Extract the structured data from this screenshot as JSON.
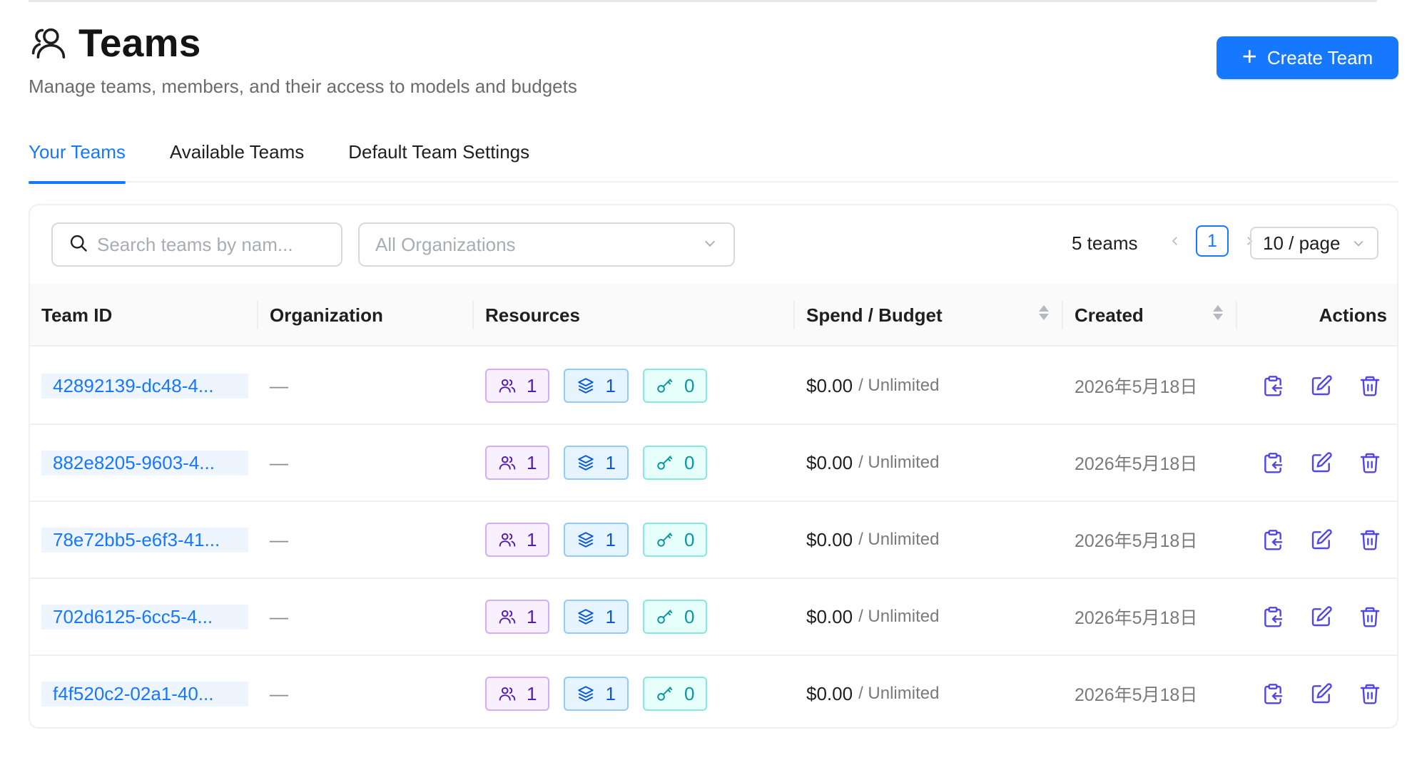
{
  "header": {
    "title": "Teams",
    "subtitle": "Manage teams, members, and their access to models and budgets",
    "create_button_label": "Create Team"
  },
  "tabs": [
    {
      "label": "Your Teams",
      "active": true
    },
    {
      "label": "Available Teams",
      "active": false
    },
    {
      "label": "Default Team Settings",
      "active": false
    }
  ],
  "toolbar": {
    "search_placeholder": "Search teams by nam...",
    "org_select_value": "All Organizations",
    "team_count": "5 teams",
    "current_page": "1",
    "page_size": "10 / page"
  },
  "table": {
    "columns": [
      "Team ID",
      "Organization",
      "Resources",
      "Spend / Budget",
      "Created",
      "Actions"
    ],
    "rows": [
      {
        "team_id": "42892139-dc48-4...",
        "organization": "—",
        "members": "1",
        "models": "1",
        "keys": "0",
        "spend": "$0.00",
        "budget": "/ Unlimited",
        "created": "2026年5月18日"
      },
      {
        "team_id": "882e8205-9603-4...",
        "organization": "—",
        "members": "1",
        "models": "1",
        "keys": "0",
        "spend": "$0.00",
        "budget": "/ Unlimited",
        "created": "2026年5月18日"
      },
      {
        "team_id": "78e72bb5-e6f3-41...",
        "organization": "—",
        "members": "1",
        "models": "1",
        "keys": "0",
        "spend": "$0.00",
        "budget": "/ Unlimited",
        "created": "2026年5月18日"
      },
      {
        "team_id": "702d6125-6cc5-4...",
        "organization": "—",
        "members": "1",
        "models": "1",
        "keys": "0",
        "spend": "$0.00",
        "budget": "/ Unlimited",
        "created": "2026年5月18日"
      },
      {
        "team_id": "f4f520c2-02a1-40...",
        "organization": "—",
        "members": "1",
        "models": "1",
        "keys": "0",
        "spend": "$0.00",
        "budget": "/ Unlimited",
        "created": "2026年5月18日"
      }
    ]
  },
  "colors": {
    "accent": "#1677ff",
    "members_badge": "#531dab",
    "models_badge": "#0958d9",
    "keys_badge": "#08979c",
    "action_icon": "#4f46e5",
    "delete_icon": "#4f46e5"
  },
  "icons": {
    "title": "users-icon",
    "search": "search-icon",
    "select": "chevron-down-icon",
    "members": "users-icon",
    "models": "layers-icon",
    "keys": "key-icon",
    "copy": "clipboard-copy-icon",
    "edit": "edit-icon",
    "delete": "trash-icon"
  }
}
